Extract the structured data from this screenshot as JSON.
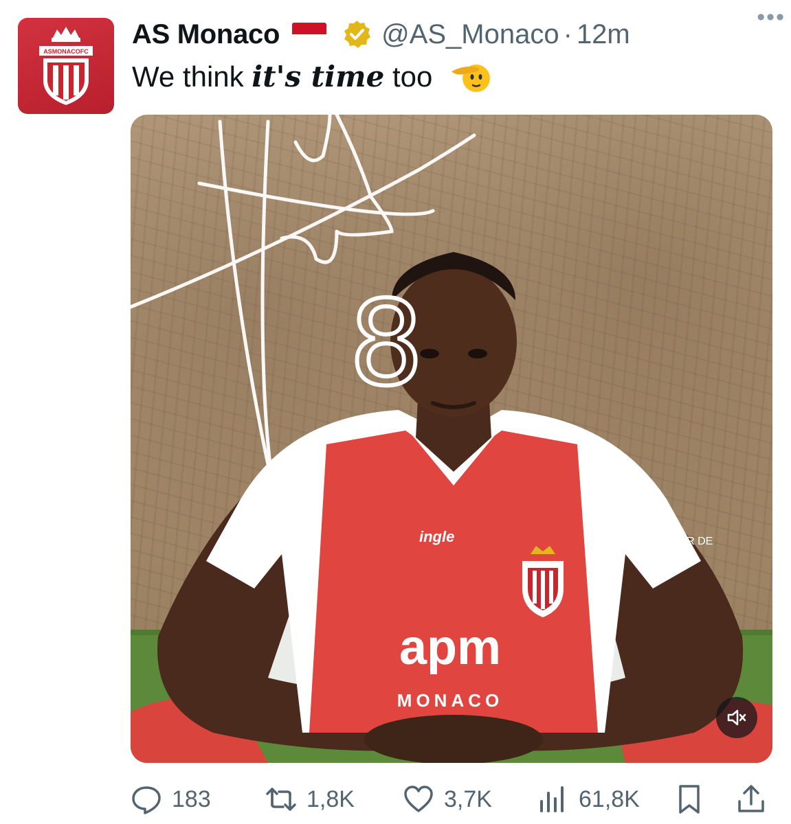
{
  "author": {
    "name": "AS Monaco",
    "flag_icon": "monaco-flag-icon",
    "verified_icon": "gold-verified-badge-icon",
    "handle": "@AS_Monaco",
    "separator": "·",
    "time": "12m",
    "avatar_text": "ASMONACOFC"
  },
  "tweet": {
    "text_prefix": "We think ",
    "text_emphasis": "it's time",
    "text_suffix": " too",
    "emoji_icon": "saluting-face-emoji"
  },
  "media": {
    "type": "video",
    "jersey_sponsor": "apm",
    "jersey_sponsor_sub": "MONACO",
    "sleeve_text": "CŒUR DE",
    "chest_text": "ingle",
    "mute_icon": "muted-speaker-icon",
    "signature_number": "8"
  },
  "actions": {
    "replies": "183",
    "reposts": "1,8K",
    "likes": "3,7K",
    "views": "61,8K"
  },
  "colors": {
    "brand_red": "#c8252f",
    "verified_gold": "#e2b719",
    "secondary_text": "#536471"
  }
}
